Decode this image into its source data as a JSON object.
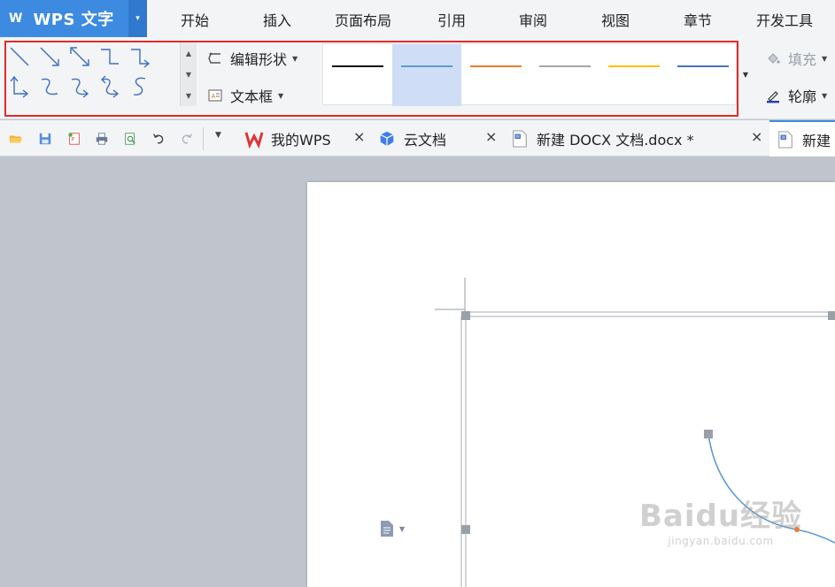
{
  "app": {
    "name": "WPS 文字",
    "logo": "W",
    "menu_arrow": "▾"
  },
  "menu": {
    "tabs": [
      "开始",
      "插入",
      "页面布局",
      "引用",
      "审阅",
      "视图",
      "章节",
      "开发工具"
    ]
  },
  "ribbon": {
    "edit_shape": "编辑形状",
    "text_box": "文本框",
    "fill": "填充",
    "outline": "轮廓",
    "line_styles": [
      {
        "color": "#111111"
      },
      {
        "color": "#5b9bd5",
        "selected": true
      },
      {
        "color": "#ed7d31"
      },
      {
        "color": "#a5a5a5"
      },
      {
        "color": "#ffc000"
      },
      {
        "color": "#4472c4"
      }
    ],
    "highlight_color": "#e12b2b"
  },
  "quick_access": [
    "open-icon",
    "save-icon",
    "export-pdf-icon",
    "print-icon",
    "print-preview-icon",
    "undo-icon",
    "redo-icon"
  ],
  "doc_tabs": [
    {
      "label": "我的WPS",
      "icon": "wps-logo-icon"
    },
    {
      "label": "云文档",
      "icon": "cloud-doc-icon"
    },
    {
      "label": "新建 DOCX 文档.docx *",
      "icon": "word-doc-icon"
    },
    {
      "label": "新建",
      "icon": "word-doc-icon"
    }
  ],
  "colors": {
    "accent": "#3d8be0",
    "connector_line": "#5b9bd5",
    "handle": "#9aa0a8",
    "midpoint": "#ed7d31"
  },
  "watermark": {
    "brand": "Baidu经验",
    "url": "jingyan.baidu.com"
  }
}
